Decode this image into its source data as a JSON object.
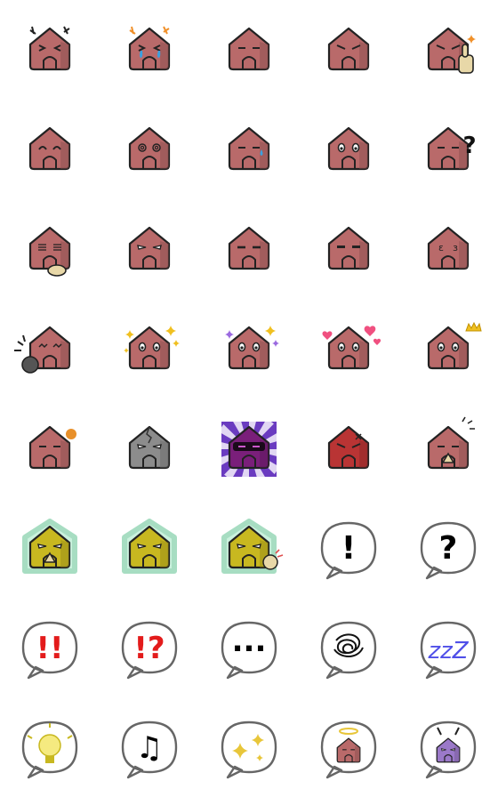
{
  "sheet": {
    "cols": 5,
    "rows": 8,
    "items": [
      {
        "kind": "house",
        "body": "#b96a6a",
        "face": "squint",
        "extra": "sweatmarks-black"
      },
      {
        "kind": "house",
        "body": "#b96a6a",
        "face": "crying",
        "extra": "sweatmarks-orange"
      },
      {
        "kind": "house",
        "body": "#b96a6a",
        "face": "neutral"
      },
      {
        "kind": "house",
        "body": "#b96a6a",
        "face": "angry"
      },
      {
        "kind": "house",
        "body": "#b96a6a",
        "face": "determined",
        "extra": "thumbs-up"
      },
      {
        "kind": "house",
        "body": "#b96a6a",
        "face": "happy"
      },
      {
        "kind": "house",
        "body": "#b96a6a",
        "face": "dizzy"
      },
      {
        "kind": "house",
        "body": "#b96a6a",
        "face": "sweat"
      },
      {
        "kind": "house",
        "body": "#b96a6a",
        "face": "shocked"
      },
      {
        "kind": "house",
        "body": "#b96a6a",
        "face": "neutral",
        "extra": "question",
        "text": "?"
      },
      {
        "kind": "house",
        "body": "#b96a6a",
        "face": "striped",
        "extra": "hand"
      },
      {
        "kind": "house",
        "body": "#b96a6a",
        "face": "blank"
      },
      {
        "kind": "house",
        "body": "#b96a6a",
        "face": "flat"
      },
      {
        "kind": "house",
        "body": "#b96a6a",
        "face": "dash"
      },
      {
        "kind": "house",
        "body": "#b96a6a",
        "face": "epsilon"
      },
      {
        "kind": "house",
        "body": "#b96a6a",
        "face": "wave",
        "extra": "hand-left"
      },
      {
        "kind": "house",
        "body": "#b96a6a",
        "face": "sparkle-eyes",
        "extra": "sparkles-gold"
      },
      {
        "kind": "house",
        "body": "#b96a6a",
        "face": "teary",
        "extra": "sparkles-purple"
      },
      {
        "kind": "house",
        "body": "#b96a6a",
        "face": "oval",
        "extra": "hearts"
      },
      {
        "kind": "house",
        "body": "#b96a6a",
        "face": "oval",
        "extra": "crown"
      },
      {
        "kind": "house",
        "body": "#b96a6a",
        "face": "sleepy",
        "extra": "ball"
      },
      {
        "kind": "house",
        "body": "#8c8c8c",
        "face": "blank",
        "extra": "crack"
      },
      {
        "kind": "house",
        "body": "#7a1f7a",
        "face": "mask",
        "extra": "purple-bg"
      },
      {
        "kind": "house",
        "body": "#b93434",
        "face": "angry",
        "extra": "anger-mark"
      },
      {
        "kind": "house",
        "body": "#b96a6a",
        "face": "sleepy",
        "extra": "pray"
      },
      {
        "kind": "house",
        "body": "#c8b820",
        "face": "glow-blank",
        "extra": "pray-glow"
      },
      {
        "kind": "house",
        "body": "#c8b820",
        "face": "glow-blank",
        "extra": "glow"
      },
      {
        "kind": "house",
        "body": "#c8b820",
        "face": "glow-blank",
        "extra": "glow-fist"
      },
      {
        "kind": "bubble",
        "text": "!",
        "color": "#000000"
      },
      {
        "kind": "bubble",
        "text": "?",
        "color": "#000000"
      },
      {
        "kind": "bubble",
        "text": "!!",
        "color": "#e31b1b"
      },
      {
        "kind": "bubble",
        "text": "!?",
        "color": "#e31b1b"
      },
      {
        "kind": "bubble",
        "text": "...",
        "color": "#000000"
      },
      {
        "kind": "bubble",
        "text": "",
        "color": "#000000",
        "extra": "scribble"
      },
      {
        "kind": "bubble",
        "text": "zzZ",
        "color": "#4f4fe8"
      },
      {
        "kind": "bubble",
        "text": "",
        "color": "#e8d83a",
        "extra": "bulb"
      },
      {
        "kind": "bubble",
        "text": "♫",
        "color": "#000000"
      },
      {
        "kind": "bubble",
        "text": "",
        "color": "#e8c63a",
        "extra": "sparkles"
      },
      {
        "kind": "bubble",
        "text": "",
        "color": "#b96a6a",
        "extra": "mini-house-halo"
      },
      {
        "kind": "bubble",
        "text": "",
        "color": "#9b79c9",
        "extra": "mini-house-antenna"
      }
    ]
  }
}
